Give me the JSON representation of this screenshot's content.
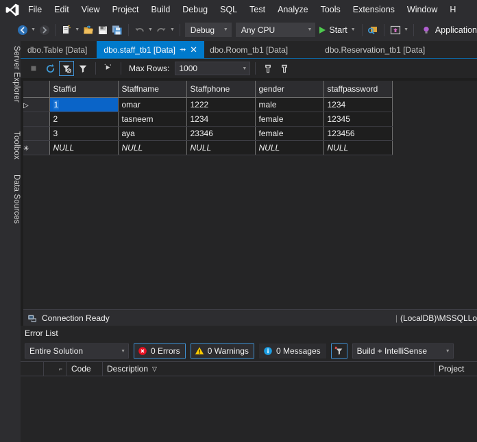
{
  "menubar": {
    "logo_icon": "visual-studio-logo",
    "items": [
      "File",
      "Edit",
      "View",
      "Project",
      "Build",
      "Debug",
      "SQL",
      "Test",
      "Analyze",
      "Tools",
      "Extensions",
      "Window",
      "H"
    ]
  },
  "toolbar": {
    "nav_back_icon": "navigate-back-icon",
    "nav_forward_icon": "navigate-forward-icon",
    "new_item_icon": "new-item-icon",
    "open_file_icon": "open-file-icon",
    "save_icon": "save-icon",
    "save_all_icon": "save-all-icon",
    "undo_icon": "undo-icon",
    "redo_icon": "redo-icon",
    "configuration": "Debug",
    "platform": "Any CPU",
    "start_label": "Start",
    "start_icon": "play-icon",
    "search_icon": "quick-launch-icon",
    "preview_icon": "preview-window-icon",
    "overflow_icon": "toolbar-overflow-icon",
    "app_insights_icon": "lightbulb-icon",
    "app_insights_label": "Application"
  },
  "leftdock": {
    "tabs": [
      "Server Explorer",
      "Toolbox",
      "Data Sources"
    ]
  },
  "tabs": [
    {
      "label": "dbo.Table [Data]",
      "active": false,
      "pinned": false,
      "closable": false
    },
    {
      "label": "dbo.staff_tb1 [Data]",
      "active": true,
      "pinned": true,
      "closable": true,
      "pin_icon": "pin-icon",
      "close_icon": "close-icon"
    },
    {
      "label": "dbo.Room_tb1 [Data]",
      "active": false,
      "pinned": false,
      "closable": false
    },
    {
      "label": "dbo.Reservation_tb1 [Data]",
      "active": false,
      "pinned": false,
      "closable": false
    }
  ],
  "gridtoolbar": {
    "stop_icon": "stop-icon",
    "refresh_icon": "refresh-icon",
    "clear_filter_icon": "clear-filter-icon",
    "filter_icon": "filter-icon",
    "script_icon": "script-icon",
    "max_rows_label": "Max Rows:",
    "max_rows_value": "1000",
    "new_query_icon": "new-query-icon",
    "new_query_alt_icon": "new-query-alt-icon"
  },
  "grid": {
    "columns": [
      "Staffid",
      "Staffname",
      "Staffphone",
      "gender",
      "staffpassword"
    ],
    "rows": [
      {
        "marker": "current",
        "marker_icon": "current-row-arrow-icon",
        "cells": [
          "1",
          "omar",
          "1222",
          "male",
          "1234"
        ],
        "selected_cell": 0
      },
      {
        "marker": "",
        "marker_icon": "",
        "cells": [
          "2",
          "tasneem",
          "1234",
          "female",
          "12345"
        ],
        "selected_cell": -1
      },
      {
        "marker": "",
        "marker_icon": "",
        "cells": [
          "3",
          "aya",
          "23346",
          "female",
          "123456"
        ],
        "selected_cell": -1
      },
      {
        "marker": "new",
        "marker_icon": "new-row-icon",
        "cells": [
          "NULL",
          "NULL",
          "NULL",
          "NULL",
          "NULL"
        ],
        "selected_cell": -1,
        "is_null_row": true
      }
    ]
  },
  "connection": {
    "icon": "database-connection-icon",
    "status": "Connection Ready",
    "separator": "|",
    "server": "(LocalDB)\\MSSQLLo"
  },
  "errorlist": {
    "title": "Error List",
    "scope": "Entire Solution",
    "errors_label": "0 Errors",
    "errors_icon": "error-icon",
    "warnings_label": "0 Warnings",
    "warnings_icon": "warning-icon",
    "messages_label": "0 Messages",
    "messages_icon": "info-icon",
    "filter_icon": "clear-all-filters-icon",
    "source": "Build + IntelliSense",
    "columns": [
      "",
      "Code",
      "Description",
      "Project"
    ],
    "sort_icon": "sort-descending-icon",
    "pin_col_icon": "column-options-icon"
  },
  "colors": {
    "accent": "#007acc",
    "chrome": "#2d2d30",
    "panel": "#252526",
    "grid_cell": "#1e1e1e",
    "selection": "#0a64c8",
    "error_red": "#e81123",
    "warning_yellow": "#ffcc00",
    "info_blue": "#1b9de2",
    "start_green": "#4ec94e"
  }
}
